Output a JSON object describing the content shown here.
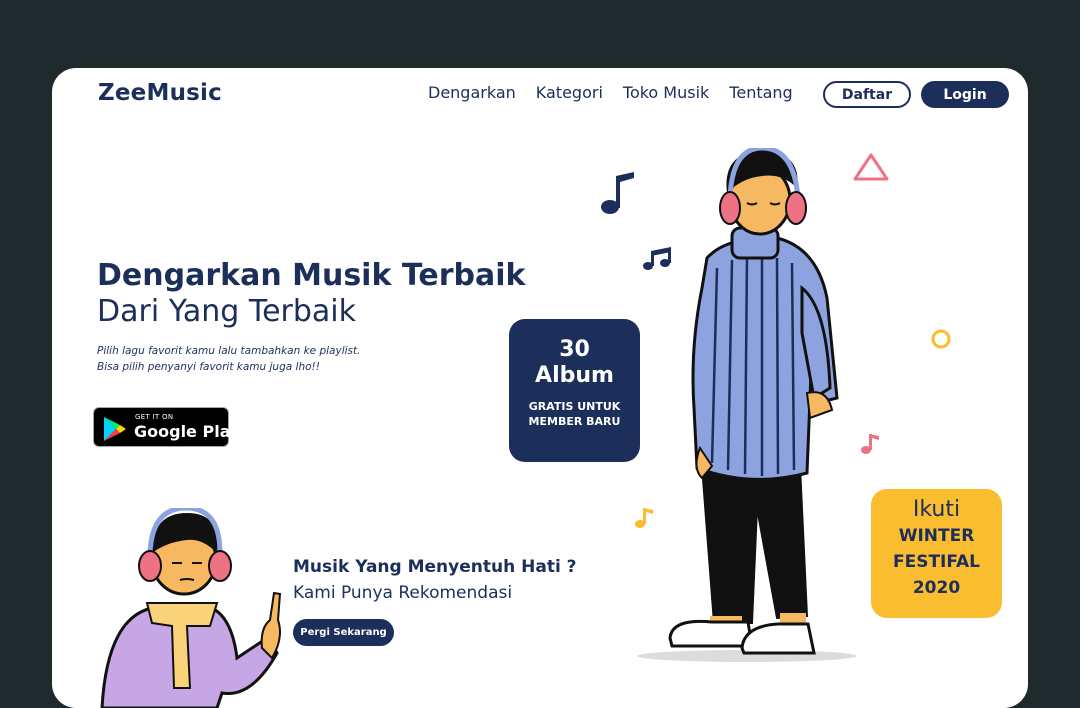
{
  "brand": {
    "logo": "ZeeMusic"
  },
  "nav": {
    "links": [
      "Dengarkan",
      "Kategori",
      "Toko Musik",
      "Tentang"
    ],
    "daftar": "Daftar",
    "login": "Login"
  },
  "hero": {
    "title": "Dengarkan Musik Terbaik",
    "subtitle": "Dari Yang Terbaik",
    "desc_line1": "Pilih lagu favorit kamu lalu tambahkan ke playlist.",
    "desc_line2": "Bisa pilih penyanyi favorit kamu juga lho!!"
  },
  "store": {
    "small": "GET IT ON",
    "big": "Google Play"
  },
  "album_badge": {
    "number": "30",
    "word": "Album",
    "note": "GRATIS UNTUK MEMBER BARU"
  },
  "festival_badge": {
    "line1": "Ikuti",
    "line2": "WINTER",
    "line3": "FESTIFAL",
    "line4": "2020"
  },
  "recommend": {
    "title": "Musik Yang Menyentuh Hati ?",
    "subtitle": "Kami Punya Rekomendasi",
    "button": "Pergi Sekarang"
  },
  "colors": {
    "navy": "#1c2e5a",
    "yellow": "#f9bd2f",
    "pink": "#ef7184",
    "sweater": "#8da3e0",
    "background": "#1f2a2d"
  },
  "icons": [
    "music-note-icon",
    "double-note-icon",
    "triangle-icon",
    "circle-icon",
    "google-play-icon"
  ]
}
